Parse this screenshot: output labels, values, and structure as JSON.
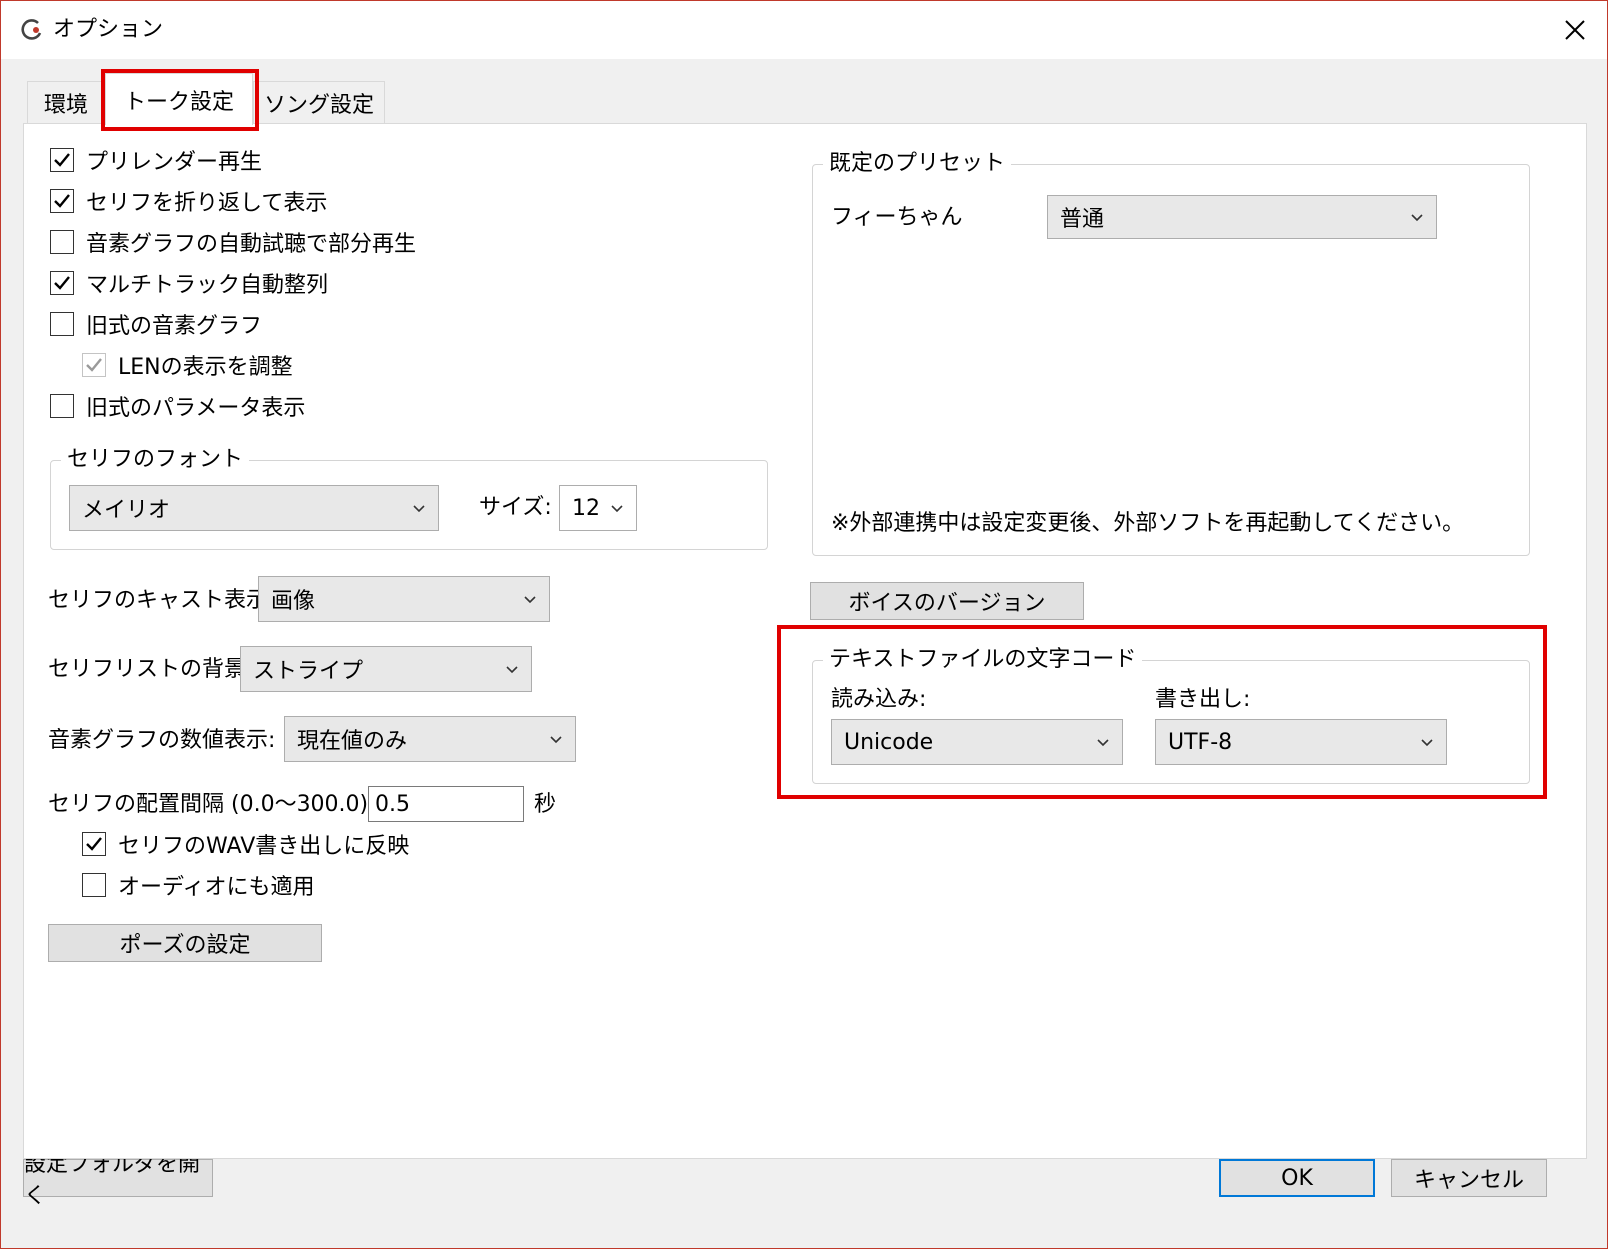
{
  "window": {
    "title": "オプション",
    "close_icon": "close-icon"
  },
  "tabs": [
    {
      "label": "環境"
    },
    {
      "label": "トーク設定"
    },
    {
      "label": "ソング設定"
    }
  ],
  "left": {
    "checkboxes": [
      {
        "label": "プリレンダー再生",
        "checked": true
      },
      {
        "label": "セリフを折り返して表示",
        "checked": true
      },
      {
        "label": "音素グラフの自動試聴で部分再生",
        "checked": false
      },
      {
        "label": "マルチトラック自動整列",
        "checked": true
      },
      {
        "label": "旧式の音素グラフ",
        "checked": false
      },
      {
        "label": "LENの表示を調整",
        "checked": true,
        "disabled": true
      },
      {
        "label": "旧式のパラメータ表示",
        "checked": false
      }
    ],
    "font_group": {
      "title": "セリフのフォント",
      "font_value": "メイリオ",
      "size_label": "サイズ:",
      "size_value": "12"
    },
    "cast_display": {
      "label": "セリフのキャスト表示:",
      "value": "画像"
    },
    "list_background": {
      "label": "セリフリストの背景:",
      "value": "ストライプ"
    },
    "phoneme_value_display": {
      "label": "音素グラフの数値表示:",
      "value": "現在値のみ"
    },
    "interval": {
      "label": "セリフの配置間隔 (0.0〜300.0):",
      "value": "0.5",
      "unit": "秒"
    },
    "sub_checkboxes": [
      {
        "label": "セリフのWAV書き出しに反映",
        "checked": true
      },
      {
        "label": "オーディオにも適用",
        "checked": false
      }
    ],
    "pause_button": "ポーズの設定"
  },
  "right": {
    "preset_group": {
      "title": "既定のプリセット",
      "character": "フィーちゃん",
      "preset_value": "普通",
      "note": "※外部連携中は設定変更後、外部ソフトを再起動してください。"
    },
    "voice_version_button": "ボイスのバージョン",
    "encoding_group": {
      "title": "テキストファイルの文字コード",
      "read_label": "読み込み:",
      "read_value": "Unicode",
      "write_label": "書き出し:",
      "write_value": "UTF-8"
    }
  },
  "footer": {
    "open_folder_button": "設定フォルダを開く",
    "ok_button": "OK",
    "cancel_button": "キャンセル"
  },
  "colors": {
    "highlight": "#e00000",
    "default_button_border": "#0078d7"
  }
}
